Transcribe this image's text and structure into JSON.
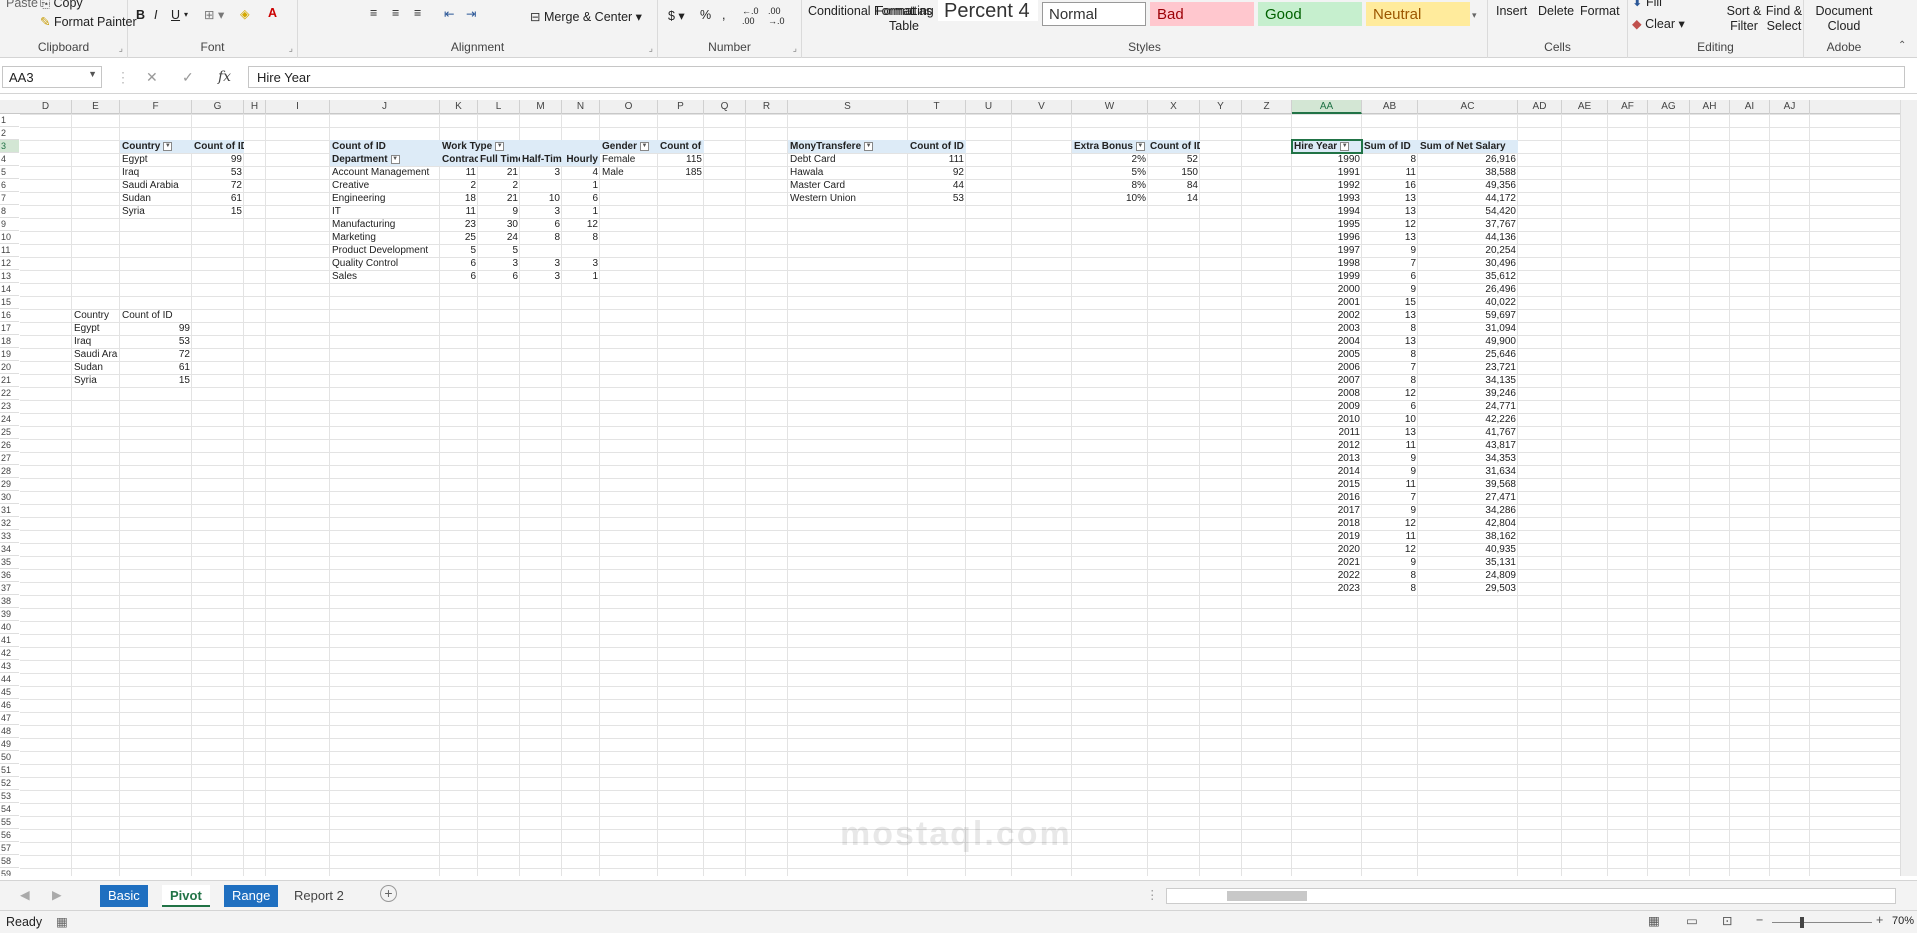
{
  "ribbon": {
    "clipboard": {
      "copy": "Copy",
      "paste": "Paste",
      "format_painter": "Format Painter",
      "label": "Clipboard"
    },
    "font": {
      "label": "Font"
    },
    "alignment": {
      "merge_center": "Merge & Center",
      "label": "Alignment"
    },
    "number": {
      "currency": "$",
      "percent": "%",
      "comma": ",",
      "label": "Number"
    },
    "styles": {
      "conditional": "Conditional Formatting",
      "format_as_table": "Format as Table",
      "percent_style": "Percent 4",
      "normal": "Normal",
      "bad": "Bad",
      "good": "Good",
      "neutral": "Neutral",
      "label": "Styles"
    },
    "cells": {
      "insert": "Insert",
      "delete": "Delete",
      "format": "Format",
      "label": "Cells"
    },
    "editing": {
      "fill": "Fill",
      "clear": "Clear",
      "sort_filter": "Sort & Filter",
      "find_select": "Find & Select",
      "label": "Editing"
    },
    "adobe": {
      "doc_cloud": "Document Cloud",
      "label": "Adobe"
    }
  },
  "formula_bar": {
    "name_box": "AA3",
    "formula": "Hire Year"
  },
  "columns": [
    "D",
    "E",
    "F",
    "G",
    "H",
    "I",
    "J",
    "K",
    "L",
    "M",
    "N",
    "O",
    "P",
    "Q",
    "R",
    "S",
    "T",
    "U",
    "V",
    "W",
    "X",
    "Y",
    "Z",
    "AA",
    "AB",
    "AC",
    "AD",
    "AE",
    "AF",
    "AG",
    "AH",
    "AI",
    "AJ"
  ],
  "pivot_country": {
    "header": [
      "Country",
      "Count of ID"
    ],
    "rows": [
      [
        "Egypt",
        "99"
      ],
      [
        "Iraq",
        "53"
      ],
      [
        "Saudi Arabia",
        "72"
      ],
      [
        "Sudan",
        "61"
      ],
      [
        "Syria",
        "15"
      ]
    ]
  },
  "country_copy": {
    "header": [
      "Country",
      "Count of ID"
    ],
    "rows": [
      [
        "Egypt",
        "99"
      ],
      [
        "Iraq",
        "53"
      ],
      [
        "Saudi Ara",
        "72"
      ],
      [
        "Sudan",
        "61"
      ],
      [
        "Syria",
        "15"
      ]
    ]
  },
  "pivot_dept": {
    "corner": "Count of ID",
    "col_field": "Work Type",
    "row_field": "Department",
    "cols": [
      "Contract",
      "Full Time",
      "Half-Time",
      "Hourly"
    ],
    "rows": [
      [
        "Account Management",
        "11",
        "21",
        "3",
        "4"
      ],
      [
        "Creative",
        "2",
        "2",
        "",
        "1"
      ],
      [
        "Engineering",
        "18",
        "21",
        "10",
        "6"
      ],
      [
        "IT",
        "11",
        "9",
        "3",
        "1"
      ],
      [
        "Manufacturing",
        "23",
        "30",
        "6",
        "12"
      ],
      [
        "Marketing",
        "25",
        "24",
        "8",
        "8"
      ],
      [
        "Product Development",
        "5",
        "5",
        "",
        ""
      ],
      [
        "Quality Control",
        "6",
        "3",
        "3",
        "3"
      ],
      [
        "Sales",
        "6",
        "6",
        "3",
        "1"
      ]
    ]
  },
  "pivot_gender": {
    "header": [
      "Gender",
      "Count of ID"
    ],
    "rows": [
      [
        "Female",
        "115"
      ],
      [
        "Male",
        "185"
      ]
    ]
  },
  "pivot_money": {
    "header": [
      "MonyTransfere",
      "Count of ID"
    ],
    "rows": [
      [
        "Debt Card",
        "111"
      ],
      [
        "Hawala",
        "92"
      ],
      [
        "Master Card",
        "44"
      ],
      [
        "Western Union",
        "53"
      ]
    ]
  },
  "pivot_bonus": {
    "header": [
      "Extra Bonus",
      "Count of ID"
    ],
    "rows": [
      [
        "2%",
        "52"
      ],
      [
        "5%",
        "150"
      ],
      [
        "8%",
        "84"
      ],
      [
        "10%",
        "14"
      ]
    ]
  },
  "pivot_hire": {
    "header": [
      "Hire Year",
      "Sum of ID",
      "Sum of Net Salary"
    ],
    "rows": [
      [
        "1990",
        "8",
        "26,916"
      ],
      [
        "1991",
        "11",
        "38,588"
      ],
      [
        "1992",
        "16",
        "49,356"
      ],
      [
        "1993",
        "13",
        "44,172"
      ],
      [
        "1994",
        "13",
        "54,420"
      ],
      [
        "1995",
        "12",
        "37,767"
      ],
      [
        "1996",
        "13",
        "44,136"
      ],
      [
        "1997",
        "9",
        "20,254"
      ],
      [
        "1998",
        "7",
        "30,496"
      ],
      [
        "1999",
        "6",
        "35,612"
      ],
      [
        "2000",
        "9",
        "26,496"
      ],
      [
        "2001",
        "15",
        "40,022"
      ],
      [
        "2002",
        "13",
        "59,697"
      ],
      [
        "2003",
        "8",
        "31,094"
      ],
      [
        "2004",
        "13",
        "49,900"
      ],
      [
        "2005",
        "8",
        "25,646"
      ],
      [
        "2006",
        "7",
        "23,721"
      ],
      [
        "2007",
        "8",
        "34,135"
      ],
      [
        "2008",
        "12",
        "39,246"
      ],
      [
        "2009",
        "6",
        "24,771"
      ],
      [
        "2010",
        "10",
        "42,226"
      ],
      [
        "2011",
        "13",
        "41,767"
      ],
      [
        "2012",
        "11",
        "43,817"
      ],
      [
        "2013",
        "9",
        "34,353"
      ],
      [
        "2014",
        "9",
        "31,634"
      ],
      [
        "2015",
        "11",
        "39,568"
      ],
      [
        "2016",
        "7",
        "27,471"
      ],
      [
        "2017",
        "9",
        "34,286"
      ],
      [
        "2018",
        "12",
        "42,804"
      ],
      [
        "2019",
        "11",
        "38,162"
      ],
      [
        "2020",
        "12",
        "40,935"
      ],
      [
        "2021",
        "9",
        "35,131"
      ],
      [
        "2022",
        "8",
        "24,809"
      ],
      [
        "2023",
        "8",
        "29,503"
      ]
    ]
  },
  "sheets": [
    "Basic",
    "Pivot",
    "Range",
    "Report 2"
  ],
  "status": {
    "ready": "Ready",
    "zoom": "70%"
  },
  "watermark": "mostaql.com",
  "colors": {
    "tab_blue": "#1f6fc0",
    "active_tab": "#217346",
    "pivot_header": "#ddebf7"
  }
}
